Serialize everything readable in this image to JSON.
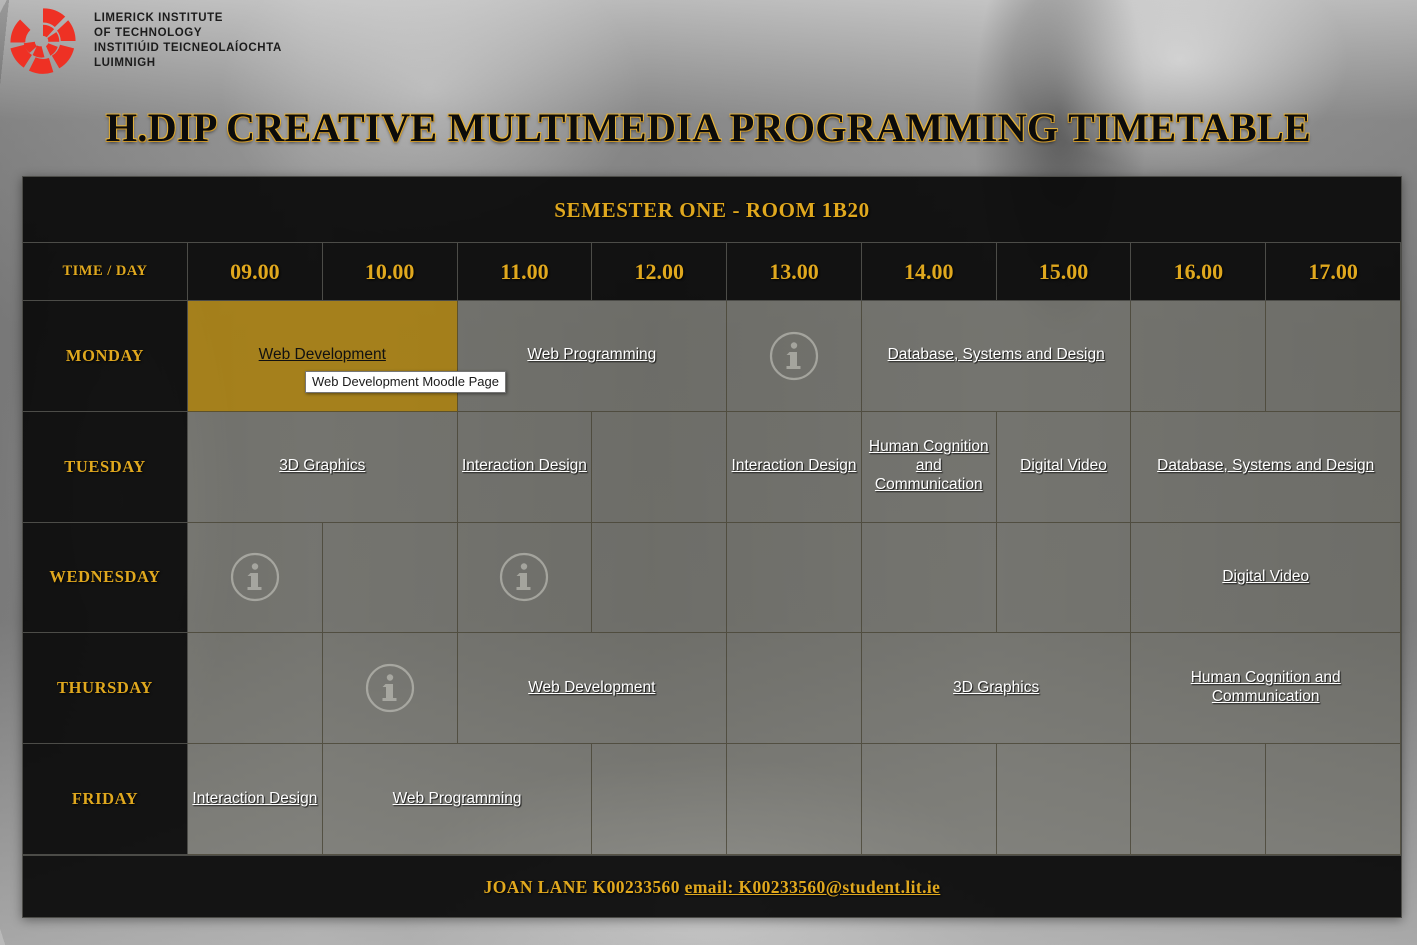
{
  "brand": {
    "logo_icon": "lit-spiral-logo-icon",
    "logo_color": "#ee3124",
    "name_lines": "LIMERICK INSTITUTE\nOF TECHNOLOGY\nINSTITIÚID TEICNEOLAÍOCHTA\nLUIMNIGH"
  },
  "page": {
    "title": "H.DIP CREATIVE MULTIMEDIA PROGRAMMING TIMETABLE",
    "semester_band": "SEMESTER ONE - ROOM 1B20",
    "accent_gold": "#e0a81e",
    "highlight_gold": "#a87e0c",
    "panel_dark": "#0b0b0b"
  },
  "table": {
    "corner_label": "TIME / DAY",
    "times": [
      "09.00",
      "10.00",
      "11.00",
      "12.00",
      "13.00",
      "14.00",
      "15.00",
      "16.00",
      "17.00"
    ],
    "days": [
      "MONDAY",
      "TUESDAY",
      "WEDNESDAY",
      "THURSDAY",
      "FRIDAY"
    ],
    "entries": {
      "monday": {
        "web_development": "Web Development",
        "web_programming": "Web Programming",
        "info_icon": "info-icon",
        "database": "Database, Systems and Design"
      },
      "tuesday": {
        "graphics": "3D Graphics",
        "interaction_design_1": "Interaction Design",
        "interaction_design_2": "Interaction Design",
        "human_cognition": "Human Cognition and Communication",
        "digital_video": "Digital Video",
        "database": "Database, Systems and Design"
      },
      "wednesday": {
        "info_icon_1": "info-icon",
        "info_icon_2": "info-icon",
        "digital_video": "Digital Video"
      },
      "thursday": {
        "info_icon": "info-icon",
        "web_development": "Web Development",
        "graphics": "3D Graphics",
        "human_cognition": "Human Cognition and Communication"
      },
      "friday": {
        "interaction_design": "Interaction Design",
        "web_programming": "Web Programming"
      }
    }
  },
  "tooltip": {
    "text": "Web Development Moodle Page"
  },
  "footer": {
    "student": "JOAN LANE K00233560",
    "email_link": "email: K00233560@student.lit.ie"
  }
}
